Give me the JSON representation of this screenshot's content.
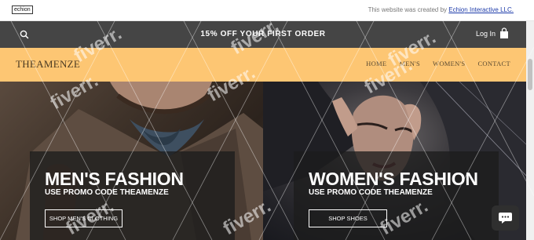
{
  "credit_bar": {
    "logo": "echion",
    "text": "This website was created by ",
    "link": "Echion Interactive LLC."
  },
  "promo_bar": {
    "search_icon": "search-icon",
    "promo": "15% OFF YOUR FIRST ORDER",
    "login": "Log In",
    "cart_icon": "shopping-bag-icon"
  },
  "nav": {
    "brand": "THEAMENZE",
    "items": [
      "HOME",
      "MEN'S",
      "WOMEN'S",
      "CONTACT"
    ]
  },
  "hero": {
    "men": {
      "title": "MEN'S FASHION",
      "subtitle": "USE PROMO CODE THEAMENZE",
      "button": "SHOP MEN'S CLOTHING"
    },
    "women": {
      "title": "WOMEN'S FASHION",
      "subtitle": "USE PROMO CODE THEAMENZE",
      "button": "SHOP SHOES"
    }
  },
  "chat": {
    "icon": "chat-bubble-icon"
  },
  "colors": {
    "promo_bg": "#454545",
    "nav_bg": "#fdc673",
    "overlay": "#1c1c1c",
    "credit_link": "#1c3aa9"
  },
  "watermark": "fiverr."
}
